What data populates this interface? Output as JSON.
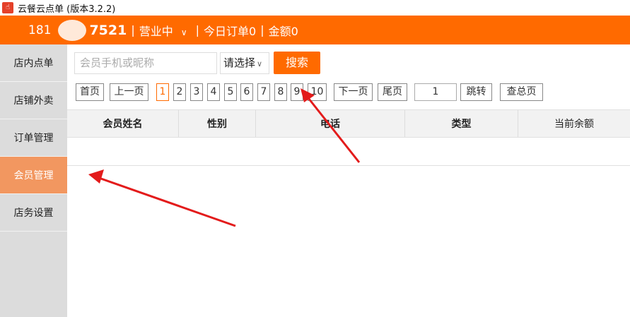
{
  "window": {
    "title": "云餐云点单 (版本3.2.2)"
  },
  "topbar": {
    "phone_prefix": "181",
    "phone_suffix": "7521",
    "status": "营业中",
    "today_orders": "今日订单0",
    "amount": "金额0",
    "sep": "|"
  },
  "sidebar": {
    "items": [
      {
        "label": "店内点单"
      },
      {
        "label": "店铺外卖"
      },
      {
        "label": "订单管理"
      },
      {
        "label": "会员管理"
      },
      {
        "label": "店务设置"
      }
    ]
  },
  "search": {
    "placeholder": "会员手机或昵称",
    "select_value": "请选择",
    "button": "搜索"
  },
  "pager": {
    "first": "首页",
    "prev": "上一页",
    "pages": [
      "1",
      "2",
      "3",
      "4",
      "5",
      "6",
      "7",
      "8",
      "9",
      "10"
    ],
    "current": "1",
    "next": "下一页",
    "last": "尾页",
    "jump_value": "1",
    "jump": "跳转",
    "total": "查总页"
  },
  "table": {
    "columns": [
      "会员姓名",
      "性别",
      "电话",
      "类型",
      "当前余额"
    ]
  },
  "colors": {
    "accent": "#ff6a00",
    "active_sidebar": "#f29760",
    "arrow": "#e31b1b"
  }
}
